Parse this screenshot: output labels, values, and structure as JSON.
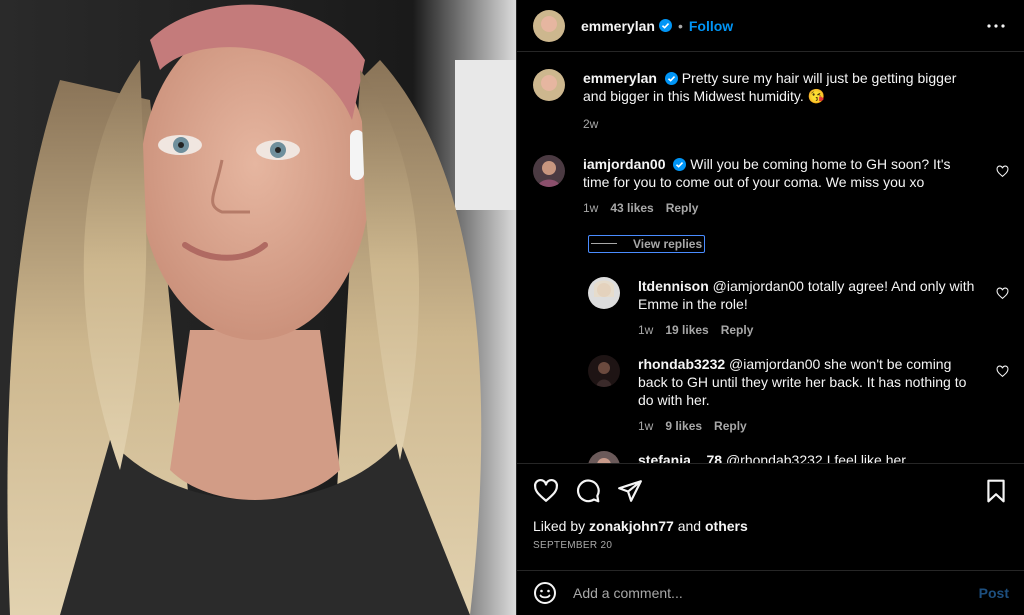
{
  "header": {
    "username": "emmerylan",
    "follow_label": "Follow"
  },
  "caption": {
    "username": "emmerylan",
    "text": "Pretty sure my hair will just be getting bigger and bigger in this Midwest humidity. 😘",
    "time": "2w"
  },
  "comment": {
    "username": "iamjordan00",
    "text": "Will you be coming home to GH soon? It's time for you to come out of your coma. We miss you xo",
    "time": "1w",
    "likes": "43 likes",
    "reply_label": "Reply",
    "view_replies_label": "View replies"
  },
  "replies": [
    {
      "username": "ltdennison",
      "text": "@iamjordan00 totally agree! And only with Emme in the role!",
      "time": "1w",
      "likes": "19 likes",
      "reply_label": "Reply"
    },
    {
      "username": "rhondab3232",
      "text": "@iamjordan00 she won't be coming back to GH until they write her back. It has nothing to do with her.",
      "time": "1w",
      "likes": "9 likes",
      "reply_label": "Reply"
    },
    {
      "username": "stefania__78",
      "text": "@rhondab3232 I feel like her"
    }
  ],
  "likes": {
    "prefix": "Liked by",
    "user": "zonakjohn77",
    "and": "and",
    "others": "others"
  },
  "date": "SEPTEMBER 20",
  "add_comment": {
    "placeholder": "Add a comment...",
    "post_label": "Post"
  },
  "colors": {
    "accent": "#0095f6",
    "verified": "#0095f6",
    "muted": "#a8a8a8",
    "post_disabled": "#1d4f7f"
  },
  "icons": [
    "verified-icon",
    "more-icon",
    "heart-icon",
    "comment-icon",
    "share-icon",
    "bookmark-icon",
    "emoji-icon"
  ]
}
